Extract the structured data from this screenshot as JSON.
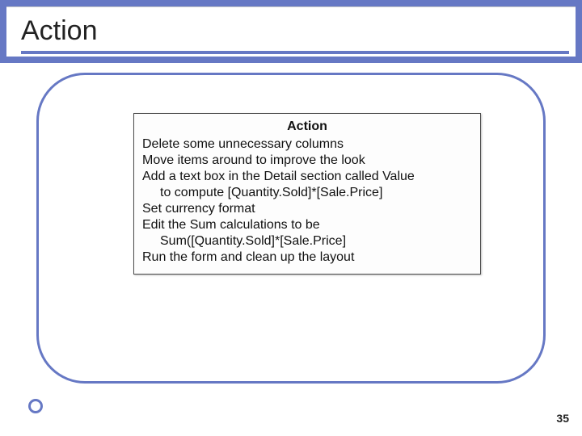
{
  "title": "Action",
  "box": {
    "header": "Action",
    "lines": [
      {
        "text": "Delete some unnecessary columns",
        "indent": false
      },
      {
        "text": "Move items around to improve the look",
        "indent": false
      },
      {
        "text": "Add a text box in the Detail section called Value",
        "indent": false
      },
      {
        "text": "to compute [Quantity.Sold]*[Sale.Price]",
        "indent": true
      },
      {
        "text": "Set currency format",
        "indent": false
      },
      {
        "text": "Edit the Sum calculations to be",
        "indent": false
      },
      {
        "text": "Sum([Quantity.Sold]*[Sale.Price]",
        "indent": true
      },
      {
        "text": "Run the form and clean up the layout",
        "indent": false
      }
    ]
  },
  "page_number": "35"
}
